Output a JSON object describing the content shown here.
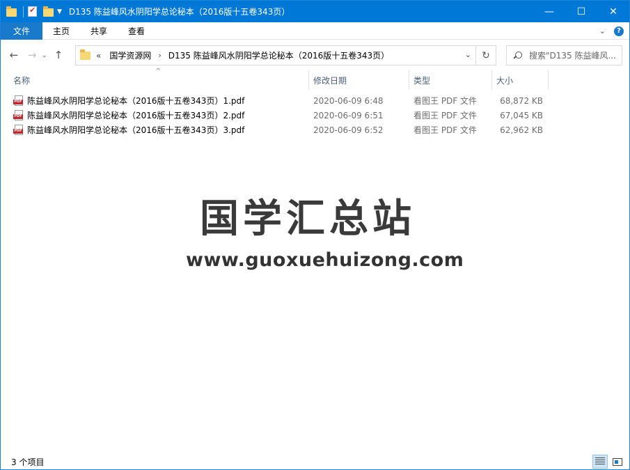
{
  "window": {
    "title": "D135 陈益峰风水阴阳学总论秘本（2016版十五卷343页）",
    "controls": {
      "minimize": "—",
      "maximize": "☐",
      "close": "✕"
    }
  },
  "ribbon": {
    "tabs": [
      "文件",
      "主页",
      "共享",
      "查看"
    ],
    "expand_icon": "chevron-down-icon",
    "help_icon": "?"
  },
  "address": {
    "overflow": "«",
    "breadcrumbs": [
      "国学资源网",
      "D135 陈益峰风水阴阳学总论秘本（2016版十五卷343页）"
    ]
  },
  "search": {
    "placeholder": "搜索\"D135 陈益峰风..."
  },
  "columns": [
    "名称",
    "修改日期",
    "类型",
    "大小"
  ],
  "files": [
    {
      "name": "陈益峰风水阴阳学总论秘本（2016版十五卷343页）1.pdf",
      "modified": "2020-06-09 6:48",
      "type": "看图王 PDF 文件",
      "size": "68,872 KB"
    },
    {
      "name": "陈益峰风水阴阳学总论秘本（2016版十五卷343页）2.pdf",
      "modified": "2020-06-09 6:51",
      "type": "看图王 PDF 文件",
      "size": "67,045 KB"
    },
    {
      "name": "陈益峰风水阴阳学总论秘本（2016版十五卷343页）3.pdf",
      "modified": "2020-06-09 6:52",
      "type": "看图王 PDF 文件",
      "size": "62,962 KB"
    }
  ],
  "watermark": {
    "title": "国学汇总站",
    "url": "www.guoxuehuizong.com"
  },
  "status": {
    "item_count": "3 个项目"
  },
  "colors": {
    "titlebar": "#0078d7",
    "file_tab": "#1979ca",
    "pdf_badge": "#c1272d"
  }
}
